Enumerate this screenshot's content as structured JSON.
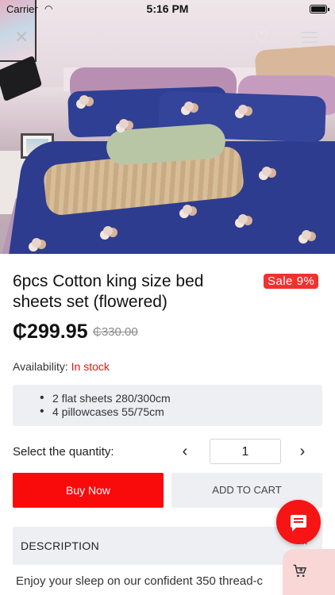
{
  "status_bar": {
    "carrier": "Carrier",
    "time": "5:16 PM"
  },
  "product": {
    "title": "6pcs Cotton king size bed sheets set (flowered)",
    "sale_badge": "Sale 9%",
    "price": "₵299.95",
    "old_price": "₵330.00",
    "availability_label": "Availability:",
    "availability_value": "In stock",
    "features": [
      "2 flat sheets 280/300cm",
      "4 pillowcases 55/75cm"
    ]
  },
  "quantity": {
    "label": "Select the quantity:",
    "value": "1",
    "decrement_glyph": "‹",
    "increment_glyph": "›"
  },
  "actions": {
    "buy_now": "Buy Now",
    "add_to_cart": "ADD TO CART"
  },
  "description": {
    "header": "DESCRIPTION",
    "text": "Enjoy your sleep on our confident 350 thread-c"
  },
  "icons": {
    "close": "close-icon",
    "favorite": "heart-icon",
    "menu": "menu-icon",
    "chat": "chat-icon",
    "cart": "add-cart-icon",
    "chevron": "chevron-up-icon"
  },
  "colors": {
    "accent": "#fa0b0b",
    "sale": "#f0322f",
    "in_stock": "#e81414",
    "panel": "#eeeff2"
  }
}
